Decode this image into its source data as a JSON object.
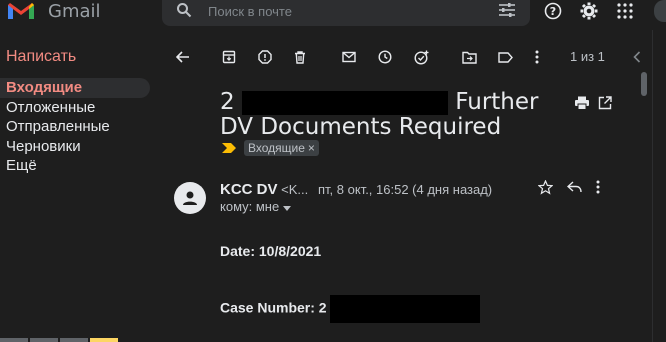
{
  "app": {
    "logo_text": "Gmail"
  },
  "search": {
    "placeholder": "Поиск в почте"
  },
  "sidebar": {
    "compose_label": "Написать",
    "items": [
      {
        "label": "Входящие",
        "active": true
      },
      {
        "label": "Отложенные"
      },
      {
        "label": "Отправленные"
      },
      {
        "label": "Черновики"
      },
      {
        "label": "Ещё"
      }
    ]
  },
  "toolbar": {
    "pager": "1 из 1",
    "icons": [
      "back-arrow-icon",
      "archive-icon",
      "report-spam-icon",
      "delete-icon",
      "mark-unread-icon",
      "snooze-icon",
      "add-task-icon",
      "move-to-icon",
      "label-icon",
      "more-vert-icon",
      "prev-icon"
    ]
  },
  "message": {
    "subject_prefix": "2",
    "subject_rest": "Further DV Documents Required",
    "label_chip": "Входящие",
    "label_chip_close": "×",
    "sender_name": "KCC DV",
    "sender_email": "<K...",
    "date": "пт, 8 окт., 16:52 (4 дня назад)",
    "to": "кому: мне",
    "body": {
      "date_line": "Date: 10/8/2021",
      "case_line": "Case Number: 2"
    }
  },
  "colors": {
    "background": "#1e1e1e",
    "accent": "#f28b82",
    "text": "#e8eaed",
    "muted": "#bdc1c6"
  }
}
